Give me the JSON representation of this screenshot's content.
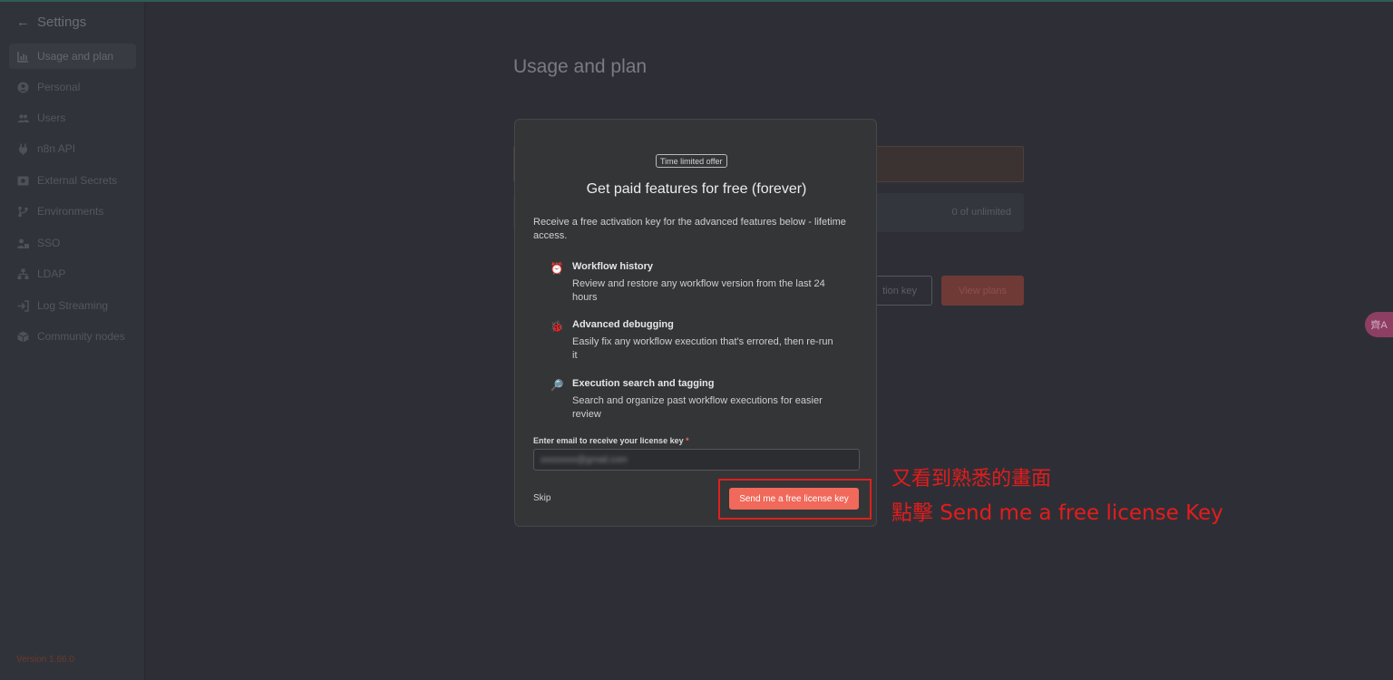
{
  "sidebar": {
    "header": "Settings",
    "items": [
      {
        "label": "Usage and plan",
        "icon": "chart-bar-icon",
        "active": true
      },
      {
        "label": "Personal",
        "icon": "user-circle-icon"
      },
      {
        "label": "Users",
        "icon": "users-icon"
      },
      {
        "label": "n8n API",
        "icon": "plug-icon"
      },
      {
        "label": "External Secrets",
        "icon": "vault-icon"
      },
      {
        "label": "Environments",
        "icon": "code-branch-icon"
      },
      {
        "label": "SSO",
        "icon": "user-lock-icon"
      },
      {
        "label": "LDAP",
        "icon": "network-icon"
      },
      {
        "label": "Log Streaming",
        "icon": "sign-in-icon"
      },
      {
        "label": "Community nodes",
        "icon": "cube-icon"
      }
    ],
    "version": "Version 1.66.0"
  },
  "main": {
    "title": "Usage and plan",
    "usage_value": "0 of unlimited",
    "activation_button_fragment": "tion key",
    "view_plans_label": "View plans"
  },
  "side_widget": {
    "icon": "translate-icon",
    "glyph": "齊A"
  },
  "modal": {
    "badge": "Time limited offer",
    "title": "Get paid features for free (forever)",
    "intro": "Receive a free activation key for the advanced features below - lifetime access.",
    "features": [
      {
        "icon": "clock-icon",
        "glyph": "⏰",
        "name": "Workflow history",
        "desc": "Review and restore any workflow version from the last 24 hours"
      },
      {
        "icon": "bug-icon",
        "glyph": "🐞",
        "name": "Advanced debugging",
        "desc": "Easily fix any workflow execution that's errored, then re-run it"
      },
      {
        "icon": "magnifier-icon",
        "glyph": "🔎",
        "name": "Execution search and tagging",
        "desc": "Search and organize past workflow executions for easier review"
      }
    ],
    "email_label": "Enter email to receive your license key",
    "email_required_mark": "*",
    "email_value": "xxxxxxxx@gmail.com",
    "skip_label": "Skip",
    "send_label": "Send me a free license key"
  },
  "annotation": {
    "line1": "又看到熟悉的畫面",
    "line2": "點擊 Send me a free license Key",
    "color": "#e41c1c"
  }
}
